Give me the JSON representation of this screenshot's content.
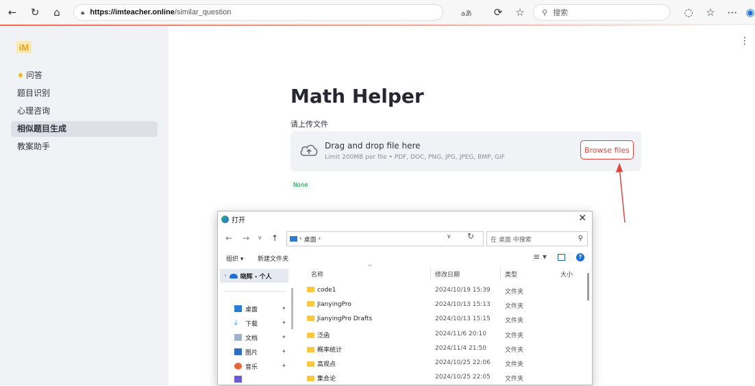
{
  "browser": {
    "url_host": "https://imteacher.online",
    "url_path": "/similar_question",
    "search_placeholder": "搜索",
    "translate_label": "aあ"
  },
  "app": {
    "logo": "iM",
    "nav_items": [
      {
        "label": "问答",
        "icon": "bulb-icon"
      },
      {
        "label": "题目识别"
      },
      {
        "label": "心理咨询"
      },
      {
        "label": "相似题目生成",
        "active": true
      },
      {
        "label": "教案助手"
      }
    ],
    "title": "Math Helper",
    "upload_label": "请上传文件",
    "dropzone": {
      "title": "Drag and drop file here",
      "limit": "Limit 200MB per file • PDF, DOC, PNG, JPG, JPEG, BMP, GIF",
      "browse_label": "Browse files"
    },
    "result_text": "None",
    "accent_color": "#e2423f"
  },
  "dialog": {
    "title": "打开",
    "path": "桌面",
    "search_placeholder": "在 桌面 中搜索",
    "toolbar": {
      "organize": "组织 ▾",
      "new_folder": "新建文件夹"
    },
    "quick_access": "晓辉 - 个人",
    "left_items": [
      {
        "label": "桌面",
        "icon": "desktop-icon"
      },
      {
        "label": "下载",
        "icon": "download-icon"
      },
      {
        "label": "文档",
        "icon": "document-icon"
      },
      {
        "label": "图片",
        "icon": "picture-icon"
      },
      {
        "label": "音乐",
        "icon": "music-icon"
      }
    ],
    "columns": {
      "name": "名称",
      "date": "修改日期",
      "type": "类型",
      "size": "大小"
    },
    "files": [
      {
        "name": "code1",
        "date": "2024/10/19 15:39",
        "type": "文件夹"
      },
      {
        "name": "JianyingPro",
        "date": "2024/10/13 15:13",
        "type": "文件夹"
      },
      {
        "name": "JianyingPro Drafts",
        "date": "2024/10/13 15:15",
        "type": "文件夹"
      },
      {
        "name": "泛函",
        "date": "2024/11/6 20:10",
        "type": "文件夹"
      },
      {
        "name": "概率统计",
        "date": "2024/11/4 21:50",
        "type": "文件夹"
      },
      {
        "name": "高观点",
        "date": "2024/10/25 22:06",
        "type": "文件夹"
      },
      {
        "name": "集合论",
        "date": "2024/10/25 22:05",
        "type": "文件夹"
      }
    ]
  }
}
